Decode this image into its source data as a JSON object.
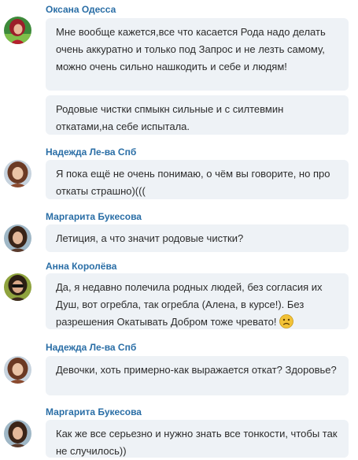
{
  "messages": [
    {
      "author": "Оксана Одесса",
      "avatar": "avatar-woman-red-hair",
      "bubbles": [
        "Мне вообще кажется,все что касается Рода надо делать очень аккуратно и только под Запрос и не лезть самому, можно очень сильно нашкодить и себе и людям!",
        "Родовые чистки спмыкн сильные и с силтевмин откатами,на себе испытала."
      ]
    },
    {
      "author": "Надежда Ле-ва Спб",
      "avatar": "avatar-woman-curly",
      "bubbles": [
        "Я пока ещё не очень понимаю, о чём вы говорите, но про откаты страшно)((("
      ]
    },
    {
      "author": "Маргарита Букесова",
      "avatar": "avatar-woman-dark-hair",
      "bubbles": [
        "Летиция, а что значит родовые чистки?"
      ]
    },
    {
      "author": "Анна Королёва",
      "avatar": "avatar-woman-sunglasses",
      "bubbles": [
        "Да, я недавно полечила родных людей, без согласия их Душ, вот огребла,  так огребла (Алена, в курсе!). Без разрешения Окатывать Добром тоже чревато!"
      ],
      "emoji": "sad-face-icon"
    },
    {
      "author": "Надежда Ле-ва Спб",
      "avatar": "avatar-woman-curly",
      "bubbles": [
        "Девочки, хоть примерно-как выражается откат? Здоровье?"
      ]
    },
    {
      "author": "Маргарита Букесова",
      "avatar": "avatar-woman-dark-hair",
      "bubbles": [
        "Как же все серьезно и нужно знать все тонкости, чтобы так не случилось))"
      ]
    }
  ]
}
